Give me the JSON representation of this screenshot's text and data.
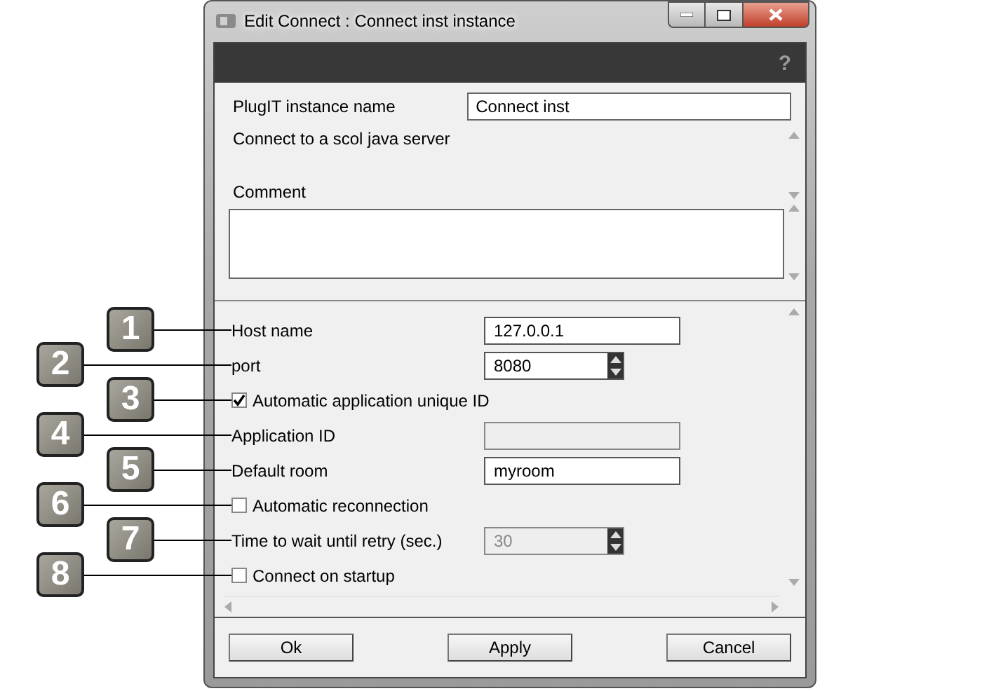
{
  "window": {
    "title": "Edit Connect : Connect inst instance"
  },
  "help": "?",
  "instance": {
    "label": "PlugIT instance name",
    "value": "Connect inst"
  },
  "description": "Connect to a scol java server",
  "comment": {
    "label": "Comment"
  },
  "settings": [
    {
      "kind": "text",
      "label": "Host name",
      "value": "127.0.0.1",
      "disabled": false,
      "callout": "1"
    },
    {
      "kind": "spinner",
      "label": "port",
      "value": "8080",
      "disabled": false,
      "callout": "2"
    },
    {
      "kind": "checkbox",
      "label": "Automatic application unique ID",
      "checked": true,
      "callout": "3"
    },
    {
      "kind": "text",
      "label": "Application ID",
      "disabled": true,
      "callout": "4"
    },
    {
      "kind": "text",
      "label": "Default room",
      "value": "myroom",
      "disabled": false,
      "callout": "5"
    },
    {
      "kind": "checkbox",
      "label": "Automatic reconnection",
      "checked": false,
      "callout": "6"
    },
    {
      "kind": "spinner",
      "label": "Time to wait until retry (sec.)",
      "value": "30",
      "disabled": true,
      "callout": "7"
    },
    {
      "kind": "checkbox",
      "label": "Connect on startup",
      "checked": false,
      "callout": "8"
    }
  ],
  "buttons": [
    "Ok",
    "Apply",
    "Cancel"
  ]
}
